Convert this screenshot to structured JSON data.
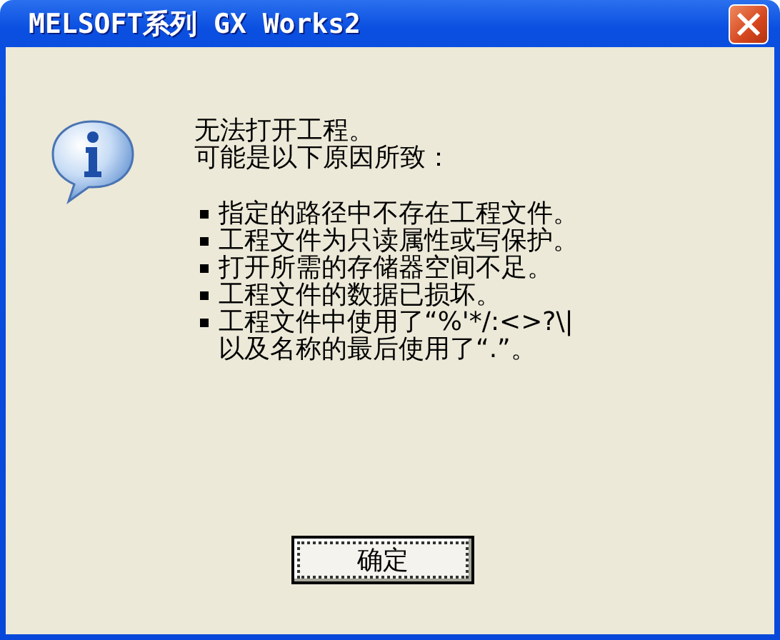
{
  "window": {
    "title": "MELSOFT系列 GX Works2"
  },
  "message": {
    "lines": [
      "无法打开工程。",
      "可能是以下原因所致："
    ],
    "reasons": [
      "指定的路径中不存在工程文件。",
      "工程文件为只读属性或写保护。",
      "打开所需的存储器空间不足。",
      "工程文件的数据已损坏。",
      "工程文件中使用了“%'*/:<>?\\|\n以及名称的最后使用了“.”。"
    ]
  },
  "buttons": [
    {
      "label": "确定",
      "focused": true
    }
  ]
}
